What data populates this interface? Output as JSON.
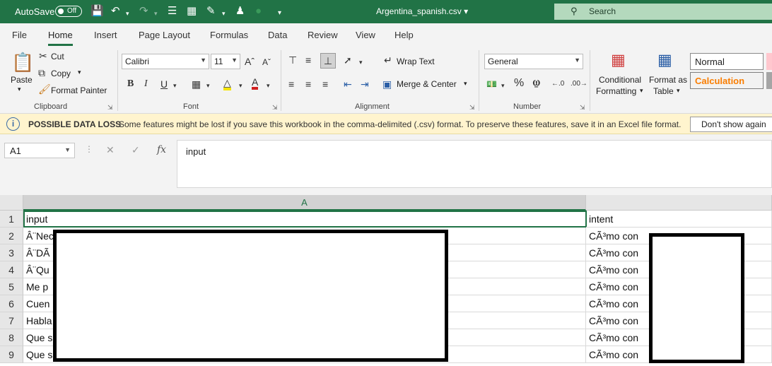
{
  "titlebar": {
    "autosave_label": "AutoSave",
    "autosave_state": "Off",
    "filename": "Argentina_spanish.csv",
    "search_placeholder": "Search"
  },
  "menu": {
    "tabs": [
      "File",
      "Home",
      "Insert",
      "Page Layout",
      "Formulas",
      "Data",
      "Review",
      "View",
      "Help"
    ],
    "active": "Home"
  },
  "ribbon": {
    "clipboard": {
      "paste": "Paste",
      "cut": "Cut",
      "copy": "Copy",
      "format_painter": "Format Painter",
      "label": "Clipboard"
    },
    "font": {
      "name": "Calibri",
      "size": "11",
      "label": "Font"
    },
    "alignment": {
      "wrap_text": "Wrap Text",
      "merge_center": "Merge & Center",
      "label": "Alignment"
    },
    "number": {
      "format": "General",
      "label": "Number"
    },
    "styles": {
      "conditional_line1": "Conditional",
      "conditional_line2": "Formatting",
      "format_as_line1": "Format as",
      "format_as_line2": "Table",
      "normal": "Normal",
      "calculation": "Calculation"
    }
  },
  "infobar": {
    "heading": "POSSIBLE DATA LOSS",
    "message": "Some features might be lost if you save this workbook in the comma-delimited (.csv) format. To preserve these features, save it in an Excel file format.",
    "button": "Don't show again"
  },
  "formula": {
    "cell_ref": "A1",
    "content": "input"
  },
  "sheet": {
    "column_a": "A",
    "rows": [
      {
        "num": "1",
        "a": "input",
        "b": "intent"
      },
      {
        "num": "2",
        "a": "Â¨Nec",
        "b": "CÃ³mo con"
      },
      {
        "num": "3",
        "a": "Â¨DÃ",
        "b": "CÃ³mo con"
      },
      {
        "num": "4",
        "a": "Â¨Qu",
        "b": "CÃ³mo con"
      },
      {
        "num": "5",
        "a": "Me p",
        "b": "CÃ³mo con"
      },
      {
        "num": "6",
        "a": "Cuen",
        "b": "CÃ³mo con"
      },
      {
        "num": "7",
        "a": "Habla",
        "b": "CÃ³mo con"
      },
      {
        "num": "8",
        "a": "Que s",
        "b": "CÃ³mo con"
      },
      {
        "num": "9",
        "a": "Que s",
        "b": "CÃ³mo con"
      }
    ]
  }
}
